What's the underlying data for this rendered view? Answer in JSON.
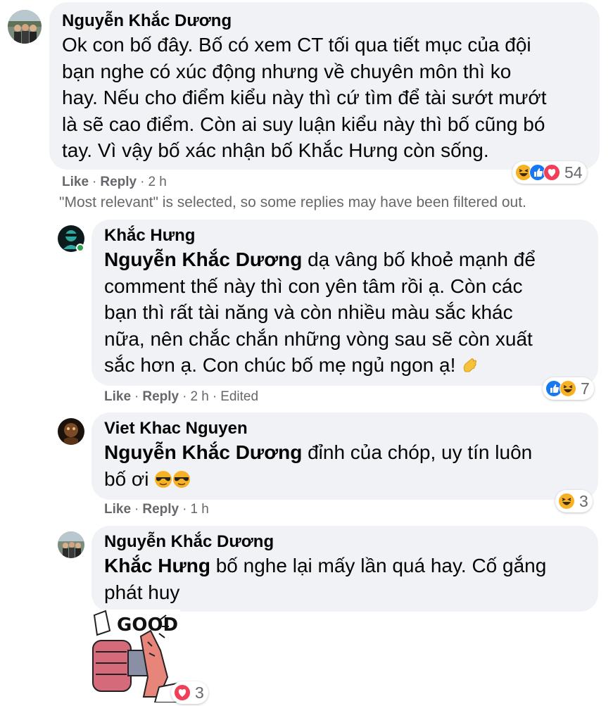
{
  "filter_note": "\"Most relevant\" is selected, so some replies may have been filtered out.",
  "comments": [
    {
      "author": "Nguyễn Khắc Dương",
      "lines": [
        "Ok con bố đây. Bố có xem CT tối qua tiết mục của đội",
        "bạn nghe có xúc động nhưng về chuyên môn thì ko",
        "hay. Nếu cho điểm kiểu này thì cứ tìm để tài sướt mướt",
        "là sẽ cao điểm. Còn ai suy luận kiểu này thì bố cũng bó",
        "tay. Vì vậy bố xác nhận bố Khắc Hưng còn sống."
      ],
      "like": "Like",
      "reply": "Reply",
      "time": "2 h",
      "reaction_count": "54",
      "reaction_icons": [
        "haha-icon",
        "like-icon",
        "love-icon"
      ]
    },
    {
      "author": "Khắc Hưng",
      "mention": "Nguyễn Khắc Dương",
      "first_line_rest": " dạ vâng bố khoẻ mạnh để",
      "lines": [
        "comment thế này thì con yên tâm rồi ạ. Còn các",
        "bạn thì rất tài năng và còn nhiều màu sắc khác",
        "nữa, nên chắc chắn những vòng sau sẽ còn xuất",
        "sắc hơn ạ. Con chúc bố mẹ ngủ ngon ạ!"
      ],
      "like": "Like",
      "reply": "Reply",
      "time": "2 h",
      "edited": "Edited",
      "reaction_count": "7",
      "reaction_icons": [
        "like-icon",
        "haha-icon"
      ]
    },
    {
      "author": "Viet Khac Nguyen",
      "mention": "Nguyễn Khắc Dương",
      "first_line_rest": " đỉnh của chóp, uy tín luôn",
      "lines": [
        "bố ơi"
      ],
      "like": "Like",
      "reply": "Reply",
      "time": "1 h",
      "reaction_count": "3",
      "reaction_icons": [
        "haha-icon"
      ]
    },
    {
      "author": "Nguyễn Khắc Dương",
      "mention": "Khắc Hưng",
      "first_line_rest": " bố nghe lại mấy lần quá hay. Cố gắng",
      "lines": [
        "phát huy"
      ],
      "sticker_text": "GOOD",
      "reaction_count": "3",
      "reaction_icons": [
        "love-icon"
      ]
    }
  ],
  "colors": {
    "bubble": "#f0f2f5",
    "meta_text": "#65676b",
    "like_blue": "#1877f2",
    "love_red": "#f33e58",
    "haha_yellow": "#f7b125",
    "online_green": "#31a24c"
  }
}
